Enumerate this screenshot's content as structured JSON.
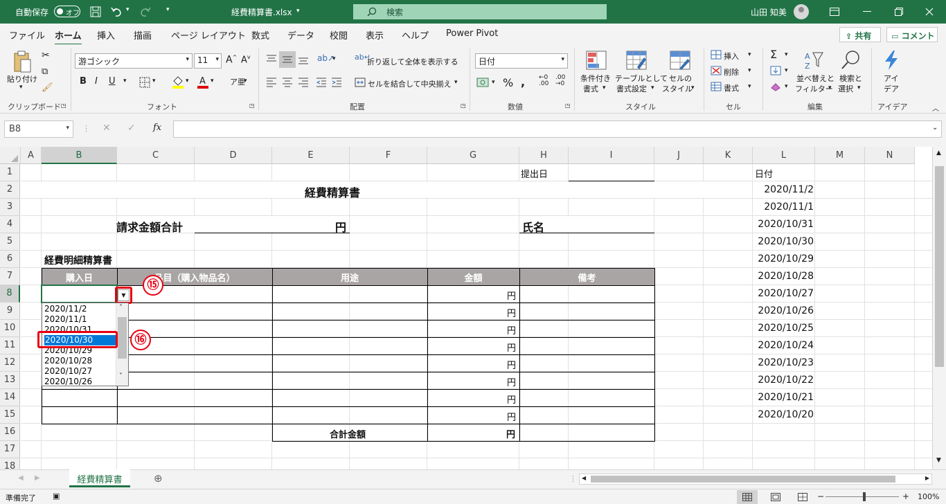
{
  "titlebar": {
    "autosave": "自動保存",
    "autosave_state": "オフ",
    "filename": "経費精算書.xlsx",
    "search_placeholder": "検索",
    "user": "山田 知美"
  },
  "tabs": [
    "ファイル",
    "ホーム",
    "挿入",
    "描画",
    "ページ レイアウト",
    "数式",
    "データ",
    "校閲",
    "表示",
    "ヘルプ",
    "Power Pivot"
  ],
  "active_tab": "ホーム",
  "share_label": "共有",
  "comment_label": "コメント",
  "ribbon": {
    "paste": "貼り付け",
    "font_name": "游ゴシック",
    "font_size": "11",
    "wrap_text": "折り返して全体を表示する",
    "merge_center": "セルを結合して中央揃え",
    "number_format": "日付",
    "cond_format": [
      "条件付き",
      "書式"
    ],
    "table_format": [
      "テーブルとして",
      "書式設定"
    ],
    "cell_style": [
      "セルの",
      "スタイル"
    ],
    "insert": "挿入",
    "delete": "削除",
    "format": "書式",
    "sort_filter": [
      "並べ替えと",
      "フィルター"
    ],
    "find_select": [
      "検索と",
      "選択"
    ],
    "ideas": [
      "アイ",
      "デア"
    ],
    "groups": {
      "clipboard": "クリップボード",
      "font": "フォント",
      "alignment": "配置",
      "number": "数値",
      "styles": "スタイル",
      "cells": "セル",
      "editing": "編集",
      "ideas": "アイデア"
    }
  },
  "namebox": "B8",
  "columns": [
    "A",
    "B",
    "C",
    "D",
    "E",
    "F",
    "G",
    "H",
    "I",
    "J",
    "K",
    "L",
    "M",
    "N"
  ],
  "rows": [
    "1",
    "2",
    "3",
    "4",
    "5",
    "6",
    "7",
    "8",
    "9",
    "10",
    "11",
    "12",
    "13",
    "14",
    "15",
    "16",
    "17",
    "18"
  ],
  "sheet": {
    "submit_date_label": "提出日",
    "title": "経費精算書",
    "total_claim_label": "請求金額合計",
    "yen": "円",
    "name_label": "氏名",
    "detail_title": "経費明細精算書",
    "table_headers": [
      "購入日",
      "品目（購入物品名）",
      "用途",
      "金額",
      "備考"
    ],
    "total_label": "合計金額",
    "date_list_header": "日付",
    "date_list": [
      "2020/11/2",
      "2020/11/1",
      "2020/10/31",
      "2020/10/30",
      "2020/10/29",
      "2020/10/28",
      "2020/10/27",
      "2020/10/26",
      "2020/10/25",
      "2020/10/24",
      "2020/10/23",
      "2020/10/22",
      "2020/10/21",
      "2020/10/20"
    ]
  },
  "dropdown": {
    "options": [
      "2020/11/2",
      "2020/11/1",
      "2020/10/31",
      "2020/10/30",
      "2020/10/29",
      "2020/10/28",
      "2020/10/27",
      "2020/10/26"
    ],
    "selected": "2020/10/30"
  },
  "callouts": [
    "⑮",
    "⑯"
  ],
  "sheet_tab": "経費精算書",
  "status": {
    "ready": "準備完了",
    "zoom": "100%"
  },
  "colors": {
    "accent": "#217346",
    "highlight": "#0078d7",
    "callout_red": "#e60012",
    "table_header_bg": "#aaa5a5"
  }
}
